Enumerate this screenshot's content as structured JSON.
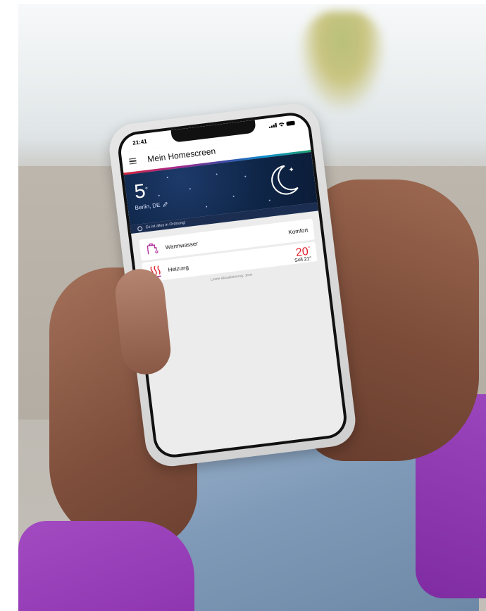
{
  "status_bar": {
    "time": "21:41"
  },
  "header": {
    "title": "Mein Homescreen"
  },
  "weather": {
    "temperature": "5",
    "unit": "°",
    "location": "Berlin, DE",
    "icon": "moon-icon"
  },
  "status": {
    "message": "Es ist alles in Ordnung!",
    "icon": "smile-icon"
  },
  "devices": [
    {
      "label": "Warmwasser",
      "value": "Komfort",
      "icon": "faucet-icon"
    },
    {
      "label": "Heizung",
      "temperature": "20",
      "unit": "°",
      "setpoint": "Soll 21°",
      "icon": "heating-icon"
    }
  ],
  "last_update": "Letzte Aktualisierung: Jetzt",
  "colors": {
    "accent_red": "#e0202c",
    "accent_magenta": "#b0319f",
    "weather_bg": "#0f2648"
  }
}
